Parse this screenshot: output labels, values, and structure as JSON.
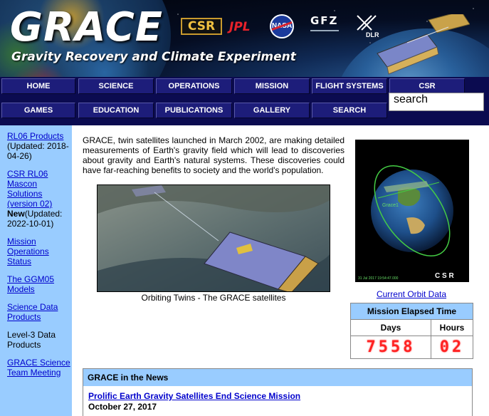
{
  "header": {
    "title": "GRACE",
    "subtitle": "Gravity Recovery and Climate Experiment",
    "logos": {
      "csr": "CSR",
      "jpl": "JPL",
      "nasa": "NASA",
      "gfz": "GFZ",
      "dlr": "DLR"
    }
  },
  "nav": {
    "row1": [
      "HOME",
      "SCIENCE",
      "OPERATIONS",
      "MISSION",
      "FLIGHT SYSTEMS",
      "CSR"
    ],
    "row2": [
      "GAMES",
      "EDUCATION",
      "PUBLICATIONS",
      "GALLERY",
      "SEARCH"
    ],
    "search_value": "search"
  },
  "sidebar": {
    "items": [
      {
        "link": "RL06 Products",
        "note_bold": "",
        "note": "(Updated: 2018-04-26)"
      },
      {
        "link": "CSR RL06 Mascon Solutions (version 02)",
        "note_bold": "New",
        "note": "(Updated: 2022-10-01)"
      },
      {
        "link": "Mission Operations Status",
        "note_bold": "",
        "note": ""
      },
      {
        "link": "The GGM05 Models",
        "note_bold": "",
        "note": ""
      },
      {
        "link": "Science Data Products",
        "note_bold": "",
        "note": ""
      },
      {
        "link": "Level-3 Data Products",
        "note_bold": "",
        "note": ""
      },
      {
        "link": "GRACE Science Team Meeting",
        "note_bold": "",
        "note": ""
      }
    ]
  },
  "main": {
    "intro": "GRACE, twin satellites launched in March 2002, are making detailed measurements of Earth's gravity field which will lead to discoveries about gravity and Earth's natural systems. These discoveries could have far-reaching benefits to society and the world's population.",
    "image_caption": "Orbiting Twins - The GRACE satellites"
  },
  "orbit": {
    "link": "Current Orbit Data",
    "image_stamp": "31 Jul 2017 19:54:47.000",
    "image_logo": "C S R",
    "image_label": "Grace1"
  },
  "mission_time": {
    "title": "Mission Elapsed Time",
    "days_label": "Days",
    "hours_label": "Hours",
    "days": "7558",
    "hours": "02"
  },
  "news": {
    "title": "GRACE in the News",
    "items": [
      {
        "headline": "Prolific Earth Gravity Satellites End Science Mission",
        "date": "October 27, 2017"
      }
    ]
  },
  "colors": {
    "nav_bg": "#0b0b50",
    "nav_button": "#1d1d7a",
    "sidebar_bg": "#99ccff",
    "link": "#0000cc",
    "led": "#ff2222"
  }
}
